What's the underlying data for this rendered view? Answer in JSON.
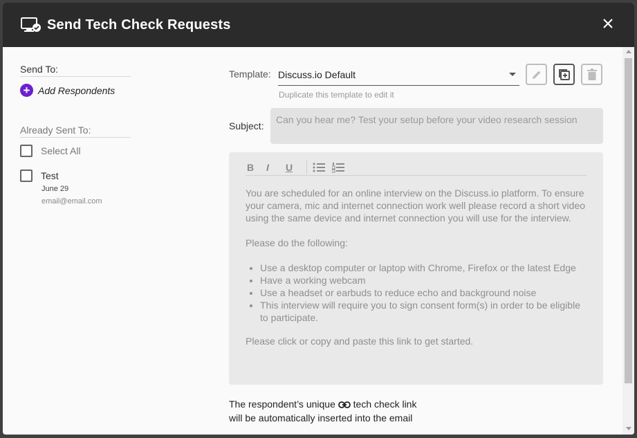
{
  "header": {
    "title": "Send Tech Check Requests"
  },
  "left": {
    "send_to_label": "Send To:",
    "add_respondents_label": "Add Respondents",
    "already_sent_label": "Already Sent To:",
    "select_all_label": "Select All",
    "respondents": [
      {
        "name": "Test",
        "date": "June 29",
        "email": "email@email.com"
      }
    ]
  },
  "template": {
    "label": "Template:",
    "selected": "Discuss.io Default",
    "hint": "Duplicate this template to edit it"
  },
  "subject": {
    "label": "Subject:",
    "value": "Can you hear me? Test your setup before your video research session"
  },
  "editor": {
    "toolbar": {
      "bold": "B",
      "italic": "I",
      "underline": "U"
    },
    "paragraph1": "You are scheduled for an online interview on the Discuss.io platform. To ensure your camera, mic and internet connection work well please record a short video using the same device and internet connection you will use for the interview.",
    "paragraph2": "Please do the following:",
    "bullets": [
      "Use a desktop computer or laptop with Chrome, Firefox or the latest Edge",
      "Have a working webcam",
      "Use a headset or earbuds to reduce echo and background noise",
      "This interview will require you to sign consent form(s) in order to be eligible to participate."
    ],
    "paragraph3": "Please click or copy and paste this link to get started."
  },
  "footer": {
    "line1_prefix": "The respondent’s unique",
    "line1_suffix": "tech check link",
    "line2": "will be automatically inserted into the email"
  },
  "colors": {
    "accent": "#6a1fd1",
    "header_bg": "#2b2b2b"
  }
}
